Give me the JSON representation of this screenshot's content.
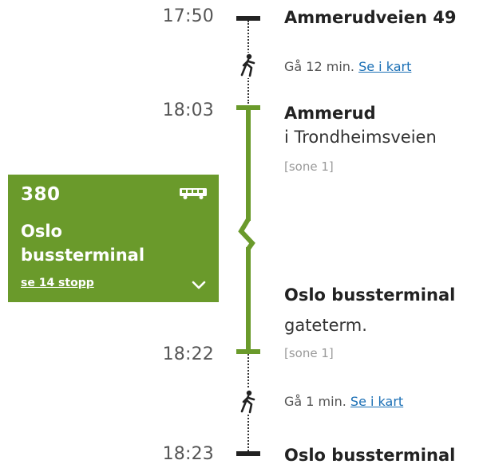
{
  "colors": {
    "route_green": "#6a9a2b",
    "link_blue": "#1a6fb5",
    "walk_line": "#333333"
  },
  "start": {
    "time": "17:50",
    "name": "Ammerudveien 49"
  },
  "walk1": {
    "icon": "walking-person-icon",
    "text": "Gå 12 min.",
    "link": "Se i kart"
  },
  "board": {
    "time": "18:03",
    "name": "Ammerud",
    "sub": "i Trondheimsveien",
    "zone": "[sone 1]"
  },
  "route": {
    "number": "380",
    "icon": "bus-icon",
    "destination_line1": "Oslo",
    "destination_line2": "bussterminal",
    "stops_link": "se 14 stopp",
    "expand_icon": "chevron-down-icon"
  },
  "alight": {
    "time": "18:22",
    "name": "Oslo bussterminal",
    "sub": "gateterm.",
    "zone": "[sone 1]"
  },
  "walk2": {
    "icon": "walking-person-icon",
    "text": "Gå 1 min.",
    "link": "Se i kart"
  },
  "end": {
    "time": "18:23",
    "name": "Oslo bussterminal"
  }
}
